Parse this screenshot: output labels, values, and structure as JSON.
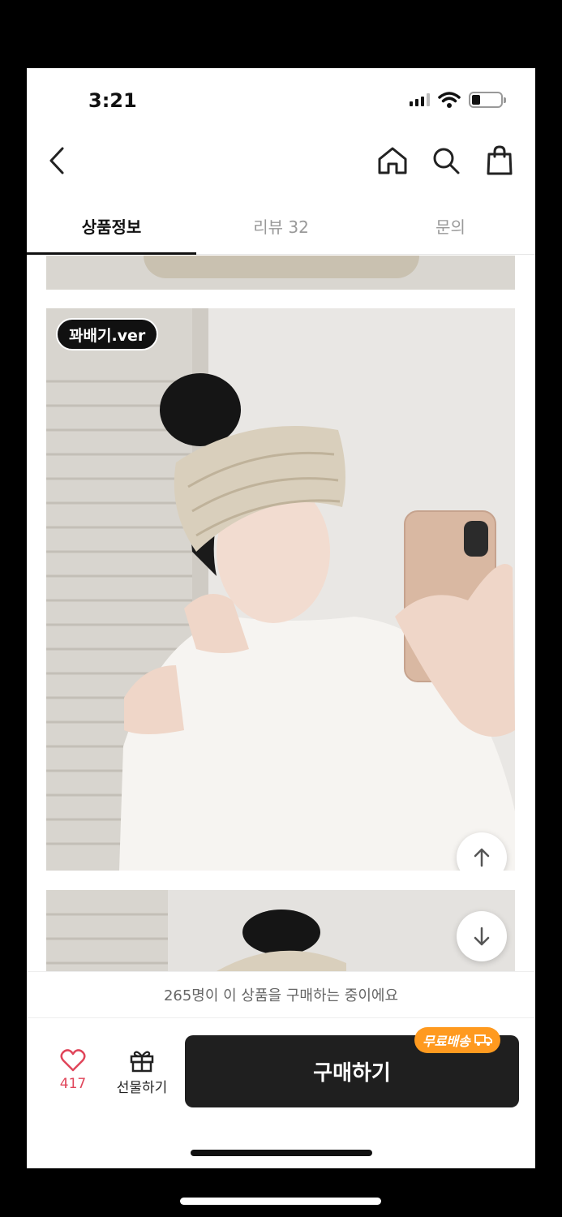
{
  "status_bar": {
    "time": "3:21"
  },
  "nav": {
    "back_icon": "chevron-left-icon",
    "right_icons": [
      "home-icon",
      "search-icon",
      "shopping-bag-icon"
    ]
  },
  "tabs": [
    {
      "label": "상품정보",
      "active": true
    },
    {
      "label": "리뷰 32",
      "active": false
    },
    {
      "label": "문의",
      "active": false
    }
  ],
  "content": {
    "badge": "꽈배기.ver"
  },
  "buying_notice": "265명이 이 상품을 구매하는 중이에요",
  "actions": {
    "like_count": "417",
    "gift_label": "선물하기",
    "buy_label": "구매하기",
    "free_shipping": "무료배송"
  },
  "colors": {
    "accent_heart": "#e0455a",
    "free_shipping_badge": "#ff9a1f",
    "buy_button": "#1f1f1f"
  }
}
